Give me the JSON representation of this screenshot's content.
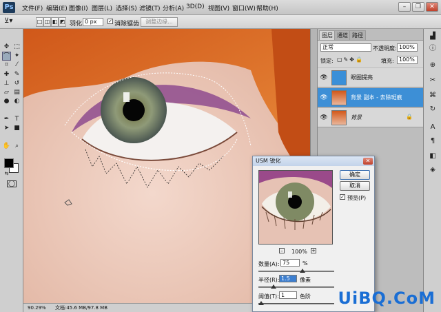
{
  "app": {
    "logo": "Ps"
  },
  "menu": [
    "文件(F)",
    "编辑(E)",
    "图像(I)",
    "图层(L)",
    "选择(S)",
    "滤镜(T)",
    "分析(A)",
    "3D(D)",
    "视图(V)",
    "窗口(W)",
    "帮助(H)"
  ],
  "window_controls": {
    "minimize": "–",
    "restore": "❐",
    "close": "✕"
  },
  "options_bar": {
    "feather_label": "羽化:",
    "feather_value": "0 px",
    "antialias_label": "消除锯齿",
    "refine_edge": "调整边缘..."
  },
  "tools": [
    "move-icon",
    "marquee-icon",
    "lasso-icon",
    "magic-wand-icon",
    "crop-icon",
    "eyedropper-icon",
    "healing-icon",
    "brush-icon",
    "stamp-icon",
    "history-brush-icon",
    "eraser-icon",
    "gradient-icon",
    "blur-icon",
    "dodge-icon",
    "pen-icon",
    "type-icon",
    "path-select-icon",
    "shape-icon",
    "hand-icon",
    "zoom-icon",
    "quickmask-icon",
    "screenmode-icon"
  ],
  "colors": {
    "foreground": "#000000",
    "background": "#ffffff",
    "selected_layer": "#3d8fd6",
    "watermark": "#1a6ed4"
  },
  "status": {
    "zoom": "90.29%",
    "doc_info": "文档:45.6 MB/97.8 MB"
  },
  "layers_panel": {
    "tabs": [
      "图层",
      "通道",
      "路径"
    ],
    "blend_mode": "正常",
    "opacity_label": "不透明度:",
    "opacity_value": "100%",
    "lock_label": "锁定:",
    "fill_label": "填充:",
    "fill_value": "100%",
    "layers": [
      {
        "name": "眼圈提亮",
        "selected": false
      },
      {
        "name": "背景 副本 - 去除斑痕",
        "selected": true
      },
      {
        "name": "背景",
        "selected": false
      }
    ]
  },
  "usm_dialog": {
    "title": "USM 锐化",
    "ok": "确定",
    "cancel": "取消",
    "preview_label": "预览(P)",
    "preview_checked": true,
    "zoom": "100%",
    "zoom_out": "–",
    "zoom_in": "+",
    "amount_label": "数量(A):",
    "amount_value": "75",
    "amount_unit": "%",
    "radius_label": "半径(R):",
    "radius_value": "1.5",
    "radius_unit": "像素",
    "threshold_label": "阈值(T):",
    "threshold_value": "1",
    "threshold_unit": "色阶"
  },
  "watermark": "UiBQ.CoM"
}
